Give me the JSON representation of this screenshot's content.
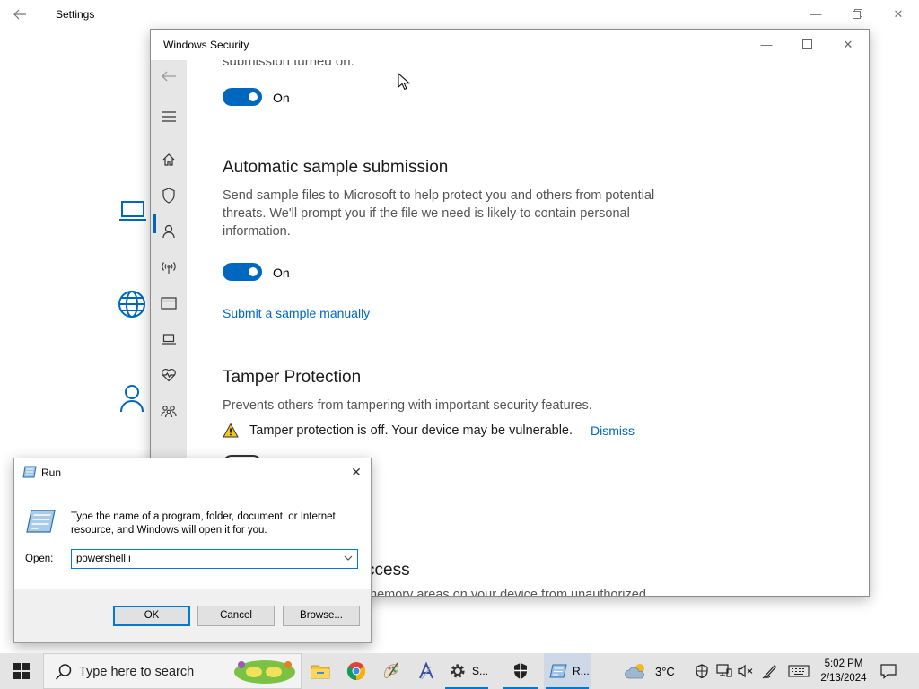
{
  "settings": {
    "title": "Settings"
  },
  "security_window": {
    "title": "Windows Security",
    "cut_off_text": "submission turned on.",
    "cloud_toggle_label": "On",
    "auto_sample": {
      "heading": "Automatic sample submission",
      "description": "Send sample files to Microsoft to help protect you and others from potential threats. We'll prompt you if the file we need is likely to contain personal information.",
      "toggle_label": "On",
      "link": "Submit a sample manually"
    },
    "tamper": {
      "heading": "Tamper Protection",
      "description": "Prevents others from tampering with important security features.",
      "warning": "Tamper protection is off. Your device may be vulnerable.",
      "dismiss": "Dismiss"
    },
    "partial_heading": "ccess",
    "partial_desc": "memory areas on your device from unauthorized"
  },
  "run_dialog": {
    "title": "Run",
    "description": "Type the name of a program, folder, document, or Internet resource, and Windows will open it for you.",
    "open_label": "Open:",
    "input_value": "powershell i",
    "ok": "OK",
    "cancel": "Cancel",
    "browse": "Browse..."
  },
  "taskbar": {
    "search_placeholder": "Type here to search",
    "settings_app_label": "S...",
    "run_app_label": "R...",
    "temperature": "3°C",
    "time": "5:02 PM",
    "date": "2/13/2024"
  },
  "colors": {
    "accent": "#0067c0",
    "warning": "#f5c518"
  }
}
